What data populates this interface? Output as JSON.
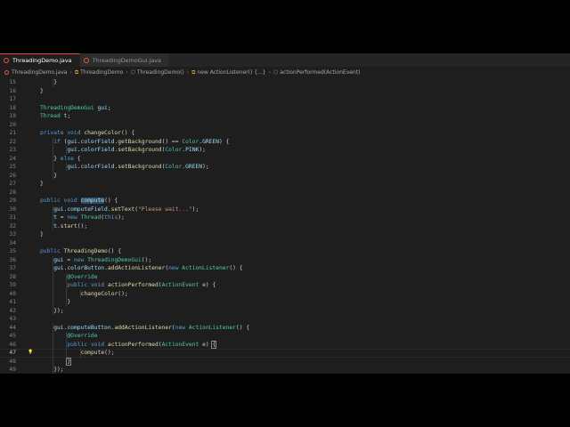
{
  "tabs": [
    {
      "label": "ThreadingDemo.java",
      "active": true
    },
    {
      "label": "ThreadingDemoGui.java",
      "active": false
    }
  ],
  "breadcrumb": [
    {
      "label": "ThreadingDemo.java",
      "icon": "java-file-icon"
    },
    {
      "label": "ThreadingDemo",
      "icon": "class-icon"
    },
    {
      "label": "ThreadingDemo()",
      "icon": "method-icon"
    },
    {
      "label": "new ActionListener() {...}",
      "icon": "class-icon"
    },
    {
      "label": "actionPerformed(ActionEvent)",
      "icon": "method-icon"
    }
  ],
  "code": {
    "lines": [
      {
        "num": "15",
        "indent": 2,
        "tokens": [
          [
            "",
            "}"
          ]
        ]
      },
      {
        "num": "16",
        "indent": 1,
        "tokens": [
          [
            "",
            "}"
          ]
        ]
      },
      {
        "num": "17",
        "indent": 0,
        "tokens": []
      },
      {
        "num": "18",
        "indent": 1,
        "tokens": [
          [
            "ty",
            "ThreadingDemoGui"
          ],
          [
            "",
            " "
          ],
          [
            "vr",
            "gui"
          ],
          [
            "",
            ";"
          ]
        ]
      },
      {
        "num": "19",
        "indent": 1,
        "tokens": [
          [
            "ty",
            "Thread"
          ],
          [
            "",
            " "
          ],
          [
            "vr",
            "t"
          ],
          [
            "",
            ";"
          ]
        ]
      },
      {
        "num": "20",
        "indent": 0,
        "tokens": []
      },
      {
        "num": "21",
        "indent": 1,
        "tokens": [
          [
            "kw",
            "private"
          ],
          [
            "",
            " "
          ],
          [
            "kw",
            "void"
          ],
          [
            "",
            " "
          ],
          [
            "fn",
            "changeColor"
          ],
          [
            "",
            "() {"
          ]
        ]
      },
      {
        "num": "22",
        "indent": 2,
        "tokens": [
          [
            "kw",
            "if"
          ],
          [
            "",
            " ("
          ],
          [
            "vr",
            "gui"
          ],
          [
            "",
            "."
          ],
          [
            "vr",
            "colorField"
          ],
          [
            "",
            "."
          ],
          [
            "fn",
            "getBackground"
          ],
          [
            "",
            "() == "
          ],
          [
            "ty",
            "Color"
          ],
          [
            "",
            "."
          ],
          [
            "vr",
            "GREEN"
          ],
          [
            "",
            ") {"
          ]
        ]
      },
      {
        "num": "23",
        "indent": 3,
        "tokens": [
          [
            "vr",
            "gui"
          ],
          [
            "",
            "."
          ],
          [
            "vr",
            "colorField"
          ],
          [
            "",
            "."
          ],
          [
            "fn",
            "setBackground"
          ],
          [
            "",
            "("
          ],
          [
            "ty",
            "Color"
          ],
          [
            "",
            "."
          ],
          [
            "vr",
            "PINK"
          ],
          [
            "",
            ");"
          ]
        ]
      },
      {
        "num": "24",
        "indent": 2,
        "tokens": [
          [
            "",
            "} "
          ],
          [
            "kw",
            "else"
          ],
          [
            "",
            " {"
          ]
        ]
      },
      {
        "num": "25",
        "indent": 3,
        "tokens": [
          [
            "vr",
            "gui"
          ],
          [
            "",
            "."
          ],
          [
            "vr",
            "colorField"
          ],
          [
            "",
            "."
          ],
          [
            "fn",
            "setBackground"
          ],
          [
            "",
            "("
          ],
          [
            "ty",
            "Color"
          ],
          [
            "",
            "."
          ],
          [
            "vr",
            "GREEN"
          ],
          [
            "",
            ");"
          ]
        ]
      },
      {
        "num": "26",
        "indent": 2,
        "tokens": [
          [
            "",
            "}"
          ]
        ]
      },
      {
        "num": "27",
        "indent": 1,
        "tokens": [
          [
            "",
            "}"
          ]
        ]
      },
      {
        "num": "28",
        "indent": 0,
        "tokens": []
      },
      {
        "num": "29",
        "indent": 1,
        "tokens": [
          [
            "kw",
            "public"
          ],
          [
            "",
            " "
          ],
          [
            "kw",
            "void"
          ],
          [
            "",
            " "
          ],
          [
            "fn hl",
            "compute"
          ],
          [
            "",
            "() {"
          ]
        ]
      },
      {
        "num": "30",
        "indent": 2,
        "tokens": [
          [
            "vr",
            "gui"
          ],
          [
            "",
            "."
          ],
          [
            "vr",
            "computeField"
          ],
          [
            "",
            "."
          ],
          [
            "fn",
            "setText"
          ],
          [
            "",
            "("
          ],
          [
            "st",
            "\"Please wait...\""
          ],
          [
            "",
            ");"
          ]
        ]
      },
      {
        "num": "31",
        "indent": 2,
        "tokens": [
          [
            "vr",
            "t"
          ],
          [
            "",
            " = "
          ],
          [
            "kw",
            "new"
          ],
          [
            "",
            " "
          ],
          [
            "ty",
            "Thread"
          ],
          [
            "",
            "("
          ],
          [
            "kw",
            "this"
          ],
          [
            "",
            ");"
          ]
        ]
      },
      {
        "num": "32",
        "indent": 2,
        "tokens": [
          [
            "vr",
            "t"
          ],
          [
            "",
            "."
          ],
          [
            "fn",
            "start"
          ],
          [
            "",
            "();"
          ]
        ]
      },
      {
        "num": "33",
        "indent": 1,
        "tokens": [
          [
            "",
            "}"
          ]
        ]
      },
      {
        "num": "34",
        "indent": 0,
        "tokens": []
      },
      {
        "num": "35",
        "indent": 1,
        "tokens": [
          [
            "kw",
            "public"
          ],
          [
            "",
            " "
          ],
          [
            "fn",
            "ThreadingDemo"
          ],
          [
            "",
            "() {"
          ]
        ]
      },
      {
        "num": "36",
        "indent": 2,
        "tokens": [
          [
            "vr",
            "gui"
          ],
          [
            "",
            " = "
          ],
          [
            "kw",
            "new"
          ],
          [
            "",
            " "
          ],
          [
            "ty",
            "ThreadingDemoGui"
          ],
          [
            "",
            "();"
          ]
        ]
      },
      {
        "num": "37",
        "indent": 2,
        "tokens": [
          [
            "vr",
            "gui"
          ],
          [
            "",
            "."
          ],
          [
            "vr",
            "colorButton"
          ],
          [
            "",
            "."
          ],
          [
            "fn",
            "addActionListener"
          ],
          [
            "",
            "("
          ],
          [
            "kw",
            "new"
          ],
          [
            "",
            " "
          ],
          [
            "ty",
            "ActionListener"
          ],
          [
            "",
            "() {"
          ]
        ]
      },
      {
        "num": "38",
        "indent": 3,
        "tokens": [
          [
            "an",
            "@Override"
          ]
        ]
      },
      {
        "num": "39",
        "indent": 3,
        "tokens": [
          [
            "kw",
            "public"
          ],
          [
            "",
            " "
          ],
          [
            "kw",
            "void"
          ],
          [
            "",
            " "
          ],
          [
            "fn",
            "actionPerformed"
          ],
          [
            "",
            "("
          ],
          [
            "ty",
            "ActionEvent"
          ],
          [
            "",
            " "
          ],
          [
            "vr",
            "e"
          ],
          [
            "",
            ") {"
          ]
        ]
      },
      {
        "num": "40",
        "indent": 4,
        "tokens": [
          [
            "fn",
            "changeColor"
          ],
          [
            "",
            "();"
          ]
        ]
      },
      {
        "num": "41",
        "indent": 3,
        "tokens": [
          [
            "",
            "}"
          ]
        ]
      },
      {
        "num": "42",
        "indent": 2,
        "tokens": [
          [
            "",
            "});"
          ]
        ]
      },
      {
        "num": "43",
        "indent": 0,
        "tokens": []
      },
      {
        "num": "44",
        "indent": 2,
        "tokens": [
          [
            "vr",
            "gui"
          ],
          [
            "",
            "."
          ],
          [
            "vr",
            "computeButton"
          ],
          [
            "",
            "."
          ],
          [
            "fn",
            "addActionListener"
          ],
          [
            "",
            "("
          ],
          [
            "kw",
            "new"
          ],
          [
            "",
            " "
          ],
          [
            "ty",
            "ActionListener"
          ],
          [
            "",
            "() {"
          ]
        ]
      },
      {
        "num": "45",
        "indent": 3,
        "tokens": [
          [
            "an",
            "@Override"
          ]
        ]
      },
      {
        "num": "46",
        "indent": 3,
        "tokens": [
          [
            "kw",
            "public"
          ],
          [
            "",
            " "
          ],
          [
            "kw",
            "void"
          ],
          [
            "",
            " "
          ],
          [
            "fn",
            "actionPerformed"
          ],
          [
            "",
            "("
          ],
          [
            "ty",
            "ActionEvent"
          ],
          [
            "",
            " "
          ],
          [
            "vr",
            "e"
          ],
          [
            "",
            ") "
          ],
          [
            "br",
            "{"
          ]
        ]
      },
      {
        "num": "47",
        "indent": 4,
        "tokens": [
          [
            "fn",
            "compute"
          ],
          [
            "",
            "();"
          ]
        ],
        "current": true,
        "bulb": true
      },
      {
        "num": "48",
        "indent": 3,
        "tokens": [
          [
            "br",
            "}"
          ]
        ]
      },
      {
        "num": "49",
        "indent": 2,
        "tokens": [
          [
            "",
            "});"
          ]
        ]
      }
    ]
  }
}
